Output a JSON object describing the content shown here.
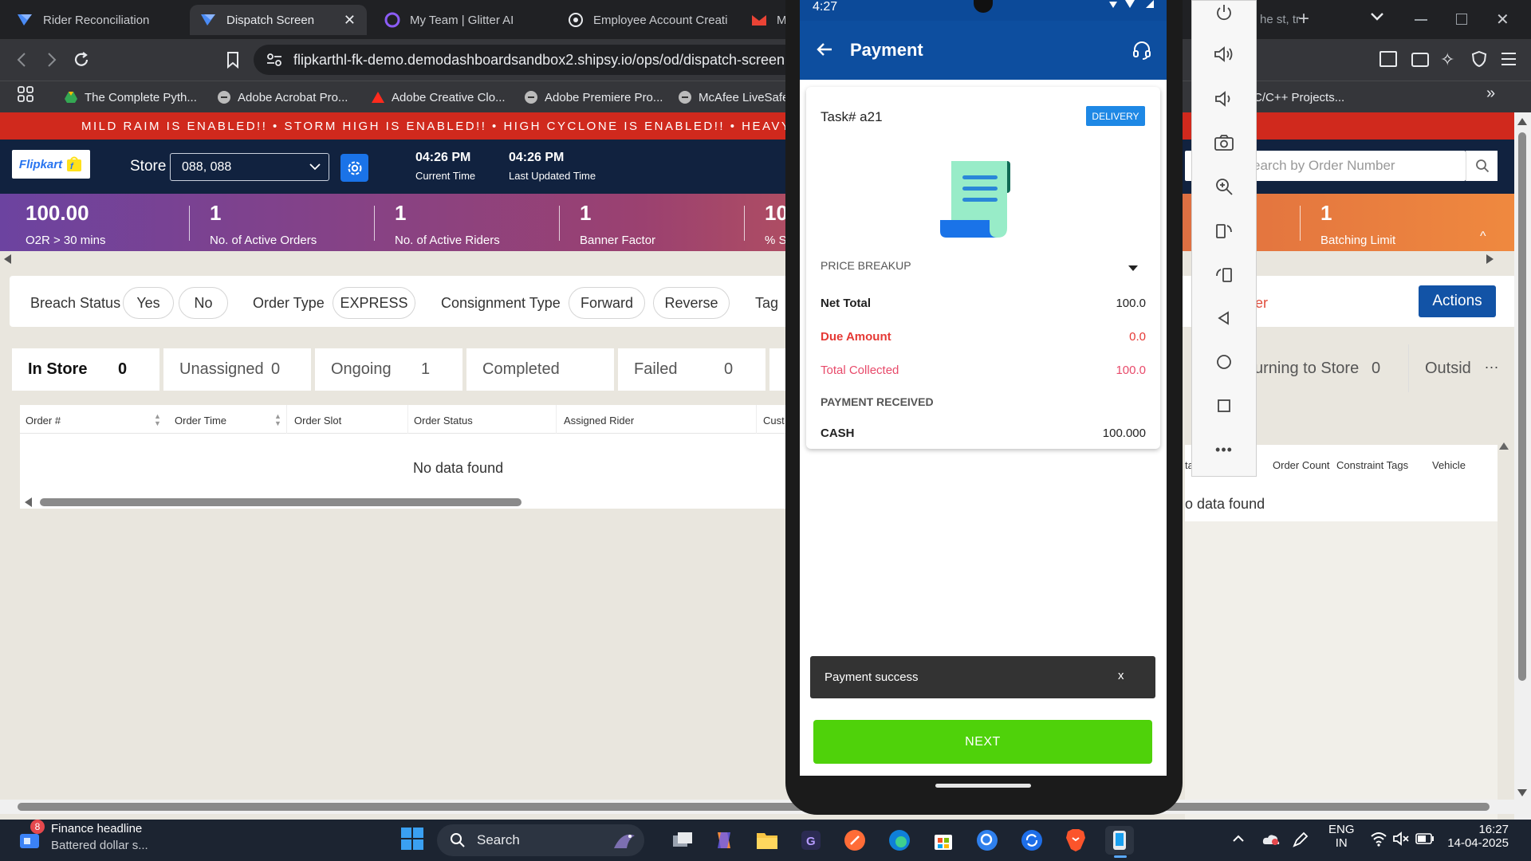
{
  "browser": {
    "tabs": [
      {
        "title": "Rider Reconciliation",
        "active": false
      },
      {
        "title": "Dispatch Screen",
        "active": true
      },
      {
        "title": "My Team | Glitter AI",
        "active": false
      },
      {
        "title": "Employee Account Creati",
        "active": false
      },
      {
        "title": "M",
        "active": false
      }
    ],
    "right_tab_fragment": "he st, tr",
    "url": "flipkarthl-fk-demo.demodashboardsandbox2.shipsy.io/ops/od/dispatch-screen",
    "bookmarks": [
      "The Complete Pyth...",
      "Adobe Acrobat Pro...",
      "Adobe Creative Clo...",
      "Adobe Premiere Pro...",
      "McAfee LiveSafe",
      "C/C++ Projects..."
    ],
    "colors": {
      "chrome_dark": "#202124",
      "chrome": "#35363a"
    }
  },
  "page": {
    "marquee": "MILD RAIM IS ENABLED!! • STORM HIGH IS ENABLED!! • HIGH CYCLONE IS ENABLED!! • HEAVY_RAIN IS ENABLED!!",
    "logo_text": "Flipkart",
    "store_label": "Store",
    "store_value": "088, 088",
    "current_time": "04:26 PM",
    "current_time_label": "Current Time",
    "last_updated_time": "04:26 PM",
    "last_updated_label": "Last Updated Time",
    "search_placeholder": "earch by Order Number",
    "metrics": [
      {
        "value": "100.00",
        "label": "O2R > 30 mins"
      },
      {
        "value": "1",
        "label": "No. of Active Orders"
      },
      {
        "value": "1",
        "label": "No. of Active Riders"
      },
      {
        "value": "1",
        "label": "Banner Factor"
      },
      {
        "value": "10",
        "label": "% S"
      },
      {
        "value": "1",
        "label": "Batching Limit"
      }
    ],
    "filters": {
      "breach_status_label": "Breach Status",
      "breach_options": [
        "Yes",
        "No"
      ],
      "order_type_label": "Order Type",
      "order_type_options": [
        "EXPRESS"
      ],
      "consignment_type_label": "Consignment Type",
      "consignment_options": [
        "Forward",
        "Reverse"
      ],
      "tag_label": "Tag",
      "rider_fragment": "er",
      "actions_label": "Actions"
    },
    "status_tabs": [
      {
        "label": "In Store",
        "count": "0",
        "active": true
      },
      {
        "label": "Unassigned",
        "count": "0"
      },
      {
        "label": "Ongoing",
        "count": "1"
      },
      {
        "label": "Completed",
        "count": ""
      },
      {
        "label": "Failed",
        "count": "0"
      },
      {
        "label": "urning to Store",
        "count": "0"
      },
      {
        "label": "Outsid",
        "count": ""
      }
    ],
    "more_label": "...",
    "table_columns": [
      "Order #",
      "Order Time",
      "Order Slot",
      "Order Status",
      "Assigned Rider",
      "Cust"
    ],
    "right_table_columns": [
      "Order Count",
      "Constraint Tags",
      "Vehicle"
    ],
    "right_table_fragment": "ta",
    "no_data": "No data found",
    "right_no_data": "o data found",
    "colors": {
      "marquee": "#d0291d",
      "header": "#11223f",
      "actions": "#1253a6"
    }
  },
  "phone": {
    "status_time": "4:27",
    "header_title": "Payment",
    "task_label": "Task#",
    "task_id": "a21",
    "badge": "DELIVERY",
    "price_breakup_label": "PRICE BREAKUP",
    "net_total_label": "Net Total",
    "net_total_value": "100.0",
    "due_amount_label": "Due Amount",
    "due_amount_value": "0.0",
    "total_collected_label": "Total Collected",
    "total_collected_value": "100.0",
    "payment_received_label": "PAYMENT RECEIVED",
    "cash_label": "CASH",
    "cash_value": "100.000",
    "toast": "Payment success",
    "toast_close": "x",
    "next_label": "NEXT",
    "colors": {
      "header": "#0d4e9f",
      "due": "#e53935",
      "collected": "#e84a6a",
      "next": "#4fd20a",
      "badge": "#1e88e5"
    }
  },
  "taskbar": {
    "news_badge": "8",
    "news_title": "Finance headline",
    "news_sub": "Battered dollar s...",
    "search": "Search",
    "lang": "ENG",
    "region": "IN",
    "time": "16:27",
    "date": "14-04-2025"
  }
}
